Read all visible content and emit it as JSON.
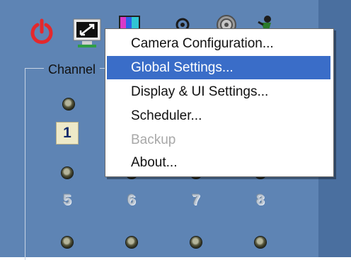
{
  "toolbar": {
    "icons": [
      "power-icon",
      "monitor-icon",
      "color-icon",
      "gear-icon",
      "target-icon",
      "person-icon"
    ],
    "accent": "#e4282c"
  },
  "group": {
    "title": "Channel"
  },
  "channels": {
    "row1": [
      "1"
    ],
    "row2": [
      "5",
      "6",
      "7",
      "8"
    ],
    "selected": "1"
  },
  "menu": {
    "items": [
      {
        "label": "Camera Configuration...",
        "state": "normal"
      },
      {
        "label": "Global Settings...",
        "state": "highlighted"
      },
      {
        "label": "Display & UI Settings...",
        "state": "normal"
      },
      {
        "label": "Scheduler...",
        "state": "normal"
      },
      {
        "label": "Backup",
        "state": "disabled"
      },
      {
        "label": "About...",
        "state": "normal"
      }
    ],
    "highlight_color": "#3a6dc8"
  }
}
